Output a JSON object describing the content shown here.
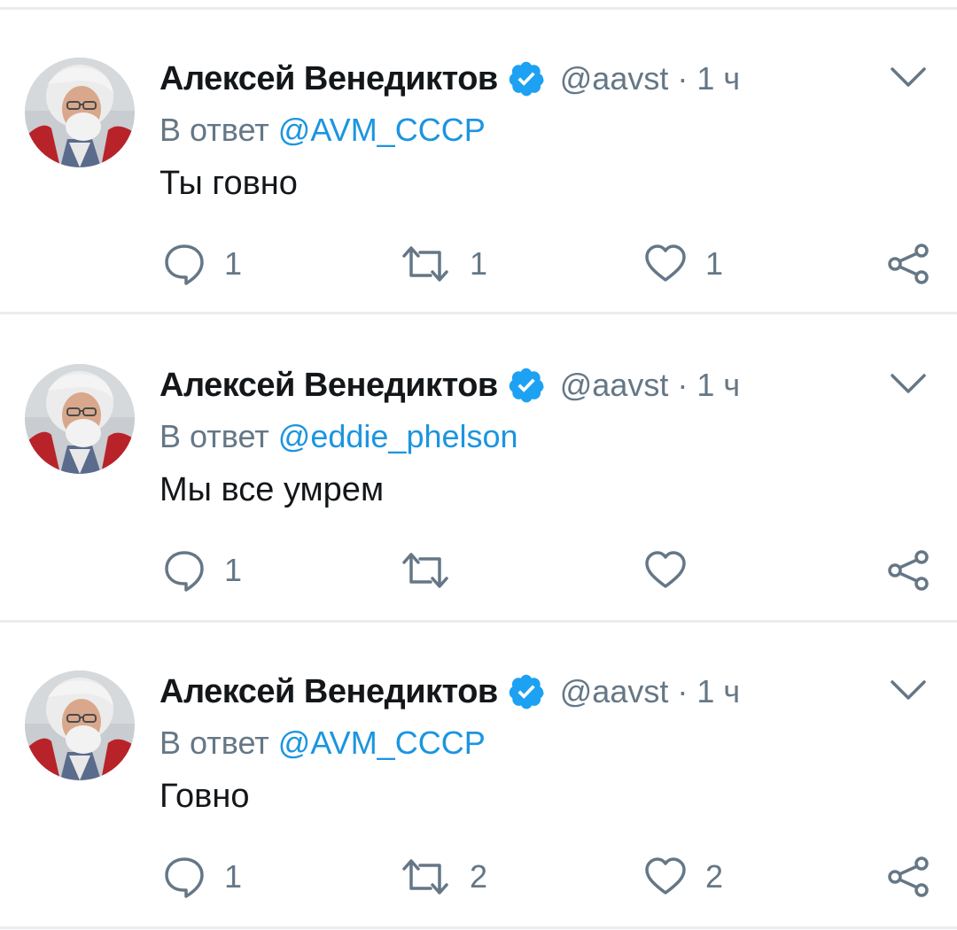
{
  "colors": {
    "name": "#14171a",
    "secondary": "#657786",
    "link": "#1b95e0",
    "verified": "#1da1f2",
    "separator": "#e9edf0"
  },
  "icons": {
    "verified": "verified-badge-icon",
    "menu": "chevron-down-icon",
    "reply": "speech-bubble-icon",
    "retweet": "retweet-arrows-icon",
    "like": "heart-outline-icon",
    "share": "share-nodes-icon"
  },
  "tweets": [
    {
      "author": "Алексей Венедиктов",
      "handle": "@aavst",
      "separator": "·",
      "time": "1 ч",
      "reply_prefix": "В ответ",
      "reply_to": "@AVM_CCCP",
      "text": "Ты говно",
      "replies": "1",
      "retweets": "1",
      "likes": "1"
    },
    {
      "author": "Алексей Венедиктов",
      "handle": "@aavst",
      "separator": "·",
      "time": "1 ч",
      "reply_prefix": "В ответ",
      "reply_to": "@eddie_phelson",
      "text": "Мы все умрем",
      "replies": "1",
      "retweets": "",
      "likes": ""
    },
    {
      "author": "Алексей Венедиктов",
      "handle": "@aavst",
      "separator": "·",
      "time": "1 ч",
      "reply_prefix": "В ответ",
      "reply_to": "@AVM_CCCP",
      "text": "Говно",
      "replies": "1",
      "retweets": "2",
      "likes": "2"
    }
  ]
}
